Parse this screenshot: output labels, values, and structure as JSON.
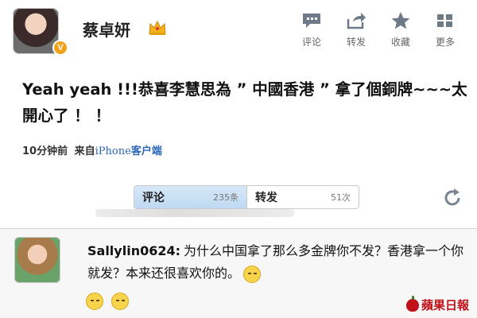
{
  "post": {
    "username": "蔡卓妍",
    "verified_badge": "V",
    "text": "Yeah yeah !!!恭喜李慧思為 ” 中國香港 ” 拿了個銅牌~~~太開心了 ！ ！",
    "time": "10分钟前",
    "source_prefix": "来自",
    "source_device": "iPhone",
    "source_suffix": "客户端"
  },
  "actions": [
    {
      "icon": "comment-icon",
      "label": "评论"
    },
    {
      "icon": "forward-icon",
      "label": "转发"
    },
    {
      "icon": "star-icon",
      "label": "收藏"
    },
    {
      "icon": "more-icon",
      "label": "更多"
    }
  ],
  "tabs": [
    {
      "label": "评论",
      "count": "235条",
      "active": true
    },
    {
      "label": "转发",
      "count": "51次",
      "active": false
    }
  ],
  "comment": {
    "user": "Sallylin0624:",
    "text": "为什么中国拿了那么多金牌你不发？香港拿一个你就发？本来还很喜欢你的。"
  },
  "watermark": "蘋果日報",
  "colors": {
    "link_blue": "#2a66b7",
    "tab_active": "#c8dff5",
    "badge_orange": "#f0a21a",
    "watermark_red": "#c0121a"
  }
}
